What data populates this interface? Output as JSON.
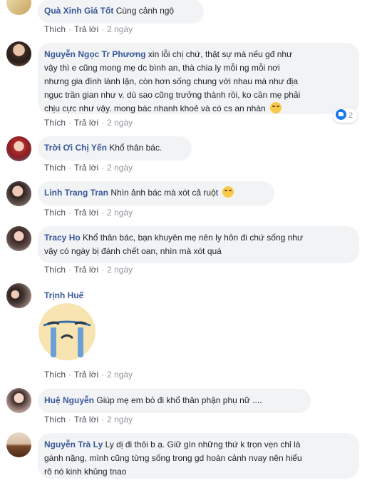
{
  "comments": [
    {
      "author": "Quà Xinh Giá Tốt",
      "text": "Cùng cảnh ngộ",
      "actions": {
        "like": "Thích",
        "reply": "Trả lời",
        "time": "2 ngày"
      }
    },
    {
      "author": "Nguyễn Ngọc Tr Phương",
      "text_lines": [
        "xin lỗi chị chứ, thật sự mà nếu gđ như",
        "vậy thì e cũng mong mẹ dc bình an, thà chia ly mỗi ng mỗi nơi",
        "nhưng gia đình lành lặn, còn hơn sống chung với nhau mà như địa",
        "ngục trần gian như v. dù sao cũng trưởng thành rồi, ko cần mẹ phải",
        "chịu cực như vậy. mong bác nhanh khoẻ và có cs an nhàn"
      ],
      "reactions": "2",
      "actions": {
        "like": "Thích",
        "reply": "Trả lời",
        "time": "2 ngày"
      }
    },
    {
      "author": "Trời Ơi Chị Yến",
      "text": "Khổ thân bác.",
      "actions": {
        "like": "Thích",
        "reply": "Trả lời",
        "time": "2 ngày"
      }
    },
    {
      "author": "Linh Trang Tran",
      "text": "Nhìn ảnh bác mà xót cả ruột",
      "actions": {
        "like": "Thích",
        "reply": "Trả lời",
        "time": "2 ngày"
      }
    },
    {
      "author": "Tracy Ho",
      "text_lines": [
        "Khổ thân bác, bạn khuyên mẹ nên ly hôn đi chứ sống như",
        "vậy có ngày bị đánh chết oan, nhìn mà xót quá"
      ],
      "actions": {
        "like": "Thích",
        "reply": "Trả lời",
        "time": "2 ngày"
      }
    },
    {
      "author": "Trịnh Huế",
      "sticker": "crying-face-sticker",
      "actions": {
        "like": "Thích",
        "reply": "Trả lời",
        "time": "2 ngày"
      }
    },
    {
      "author": "Huệ Nguyễn",
      "text": "Giúp mẹ em bỏ đi khổ thân phận phụ nữ ....",
      "actions": {
        "like": "Thích",
        "reply": "Trả lời",
        "time": "2 ngày"
      }
    },
    {
      "author": "Nguyễn Trà Ly",
      "text_lines": [
        "Ly dị đi thôi b ạ. Giữ gìn những thứ k trọn vẹn chỉ là",
        "gánh nặng, mình cũng từng sống trong gd hoàn cảnh nvay nên hiểu",
        "rõ nó kinh khủng tnao"
      ]
    }
  ],
  "colors": {
    "name": "#385898",
    "bubble": "#f2f3f5",
    "meta": "#90949c",
    "like_blue": "#1877f2"
  }
}
